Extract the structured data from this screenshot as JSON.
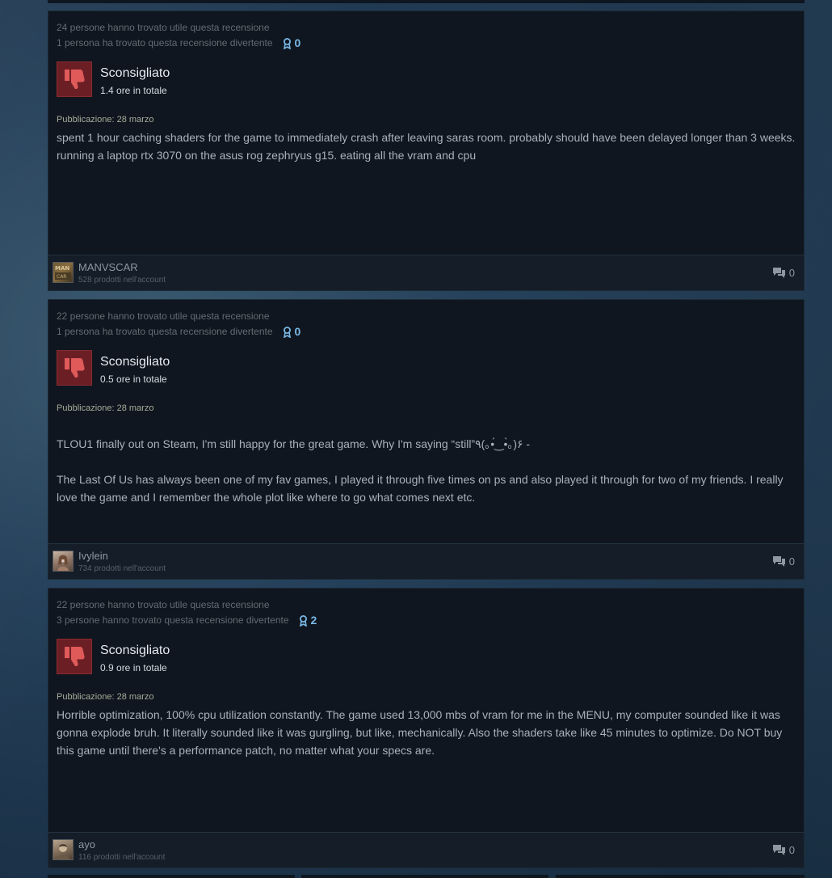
{
  "colors": {
    "panel": "#0f161f",
    "footer": "#141d28",
    "thumb_bg": "#6b1f25",
    "thumb_icon": "#e05a5a",
    "award": "#7ab8e6",
    "text": "#a9b1ba"
  },
  "reviews": [
    {
      "helpful": "24 persone hanno trovato utile questa recensione",
      "funny": "1 persona ha trovato questa recensione divertente",
      "award_count": "0",
      "verdict": "Sconsigliato",
      "hours": "1.4 ore in totale",
      "published": "Pubblicazione: 28 marzo",
      "paragraphs": [
        "spent 1 hour caching shaders for the game to immediately crash after leaving saras room. probably should have been delayed longer than 3 weeks. running a laptop rtx 3070 on the asus rog zephryus g15. eating all the vram and cpu"
      ],
      "username": "MANVSCAR",
      "products": "528 prodotti nell'account",
      "comment_count": "0",
      "avatar_icon": "avatar-manvscar-icon"
    },
    {
      "helpful": "22 persone hanno trovato utile questa recensione",
      "funny": "1 persona ha trovato questa recensione divertente",
      "award_count": "0",
      "verdict": "Sconsigliato",
      "hours": "0.5 ore in totale",
      "published": "Pubblicazione: 28 marzo",
      "paragraphs": [
        "TLOU1 finally out on Steam, I'm still happy for the great game. Why I'm saying “still”٩(｡•́‿•̀｡)۶ -",
        "The Last Of Us has always been one of my fav games, I played it through five times on ps and also played it through for two of my friends. I really love the game and I remember the whole plot like where to go what comes next etc."
      ],
      "username": "Ivylein",
      "products": "734 prodotti nell'account",
      "comment_count": "0",
      "avatar_icon": "avatar-ivylein-icon"
    },
    {
      "helpful": "22 persone hanno trovato utile questa recensione",
      "funny": "3 persone hanno trovato questa recensione divertente",
      "award_count": "2",
      "verdict": "Sconsigliato",
      "hours": "0.9 ore in totale",
      "published": "Pubblicazione: 28 marzo",
      "paragraphs": [
        "Horrible optimization, 100% cpu utilization constantly. The game used 13,000 mbs of vram for me in the MENU, my computer sounded like it was gonna explode bruh. It literally sounded like it was gurgling, but like, mechanically. Also the shaders take like 45 minutes to optimize. Do NOT buy this game until there's a performance patch, no matter what your specs are."
      ],
      "username": "ayo",
      "products": "116 prodotti nell'account",
      "comment_count": "0",
      "avatar_icon": "avatar-ayo-icon"
    }
  ]
}
